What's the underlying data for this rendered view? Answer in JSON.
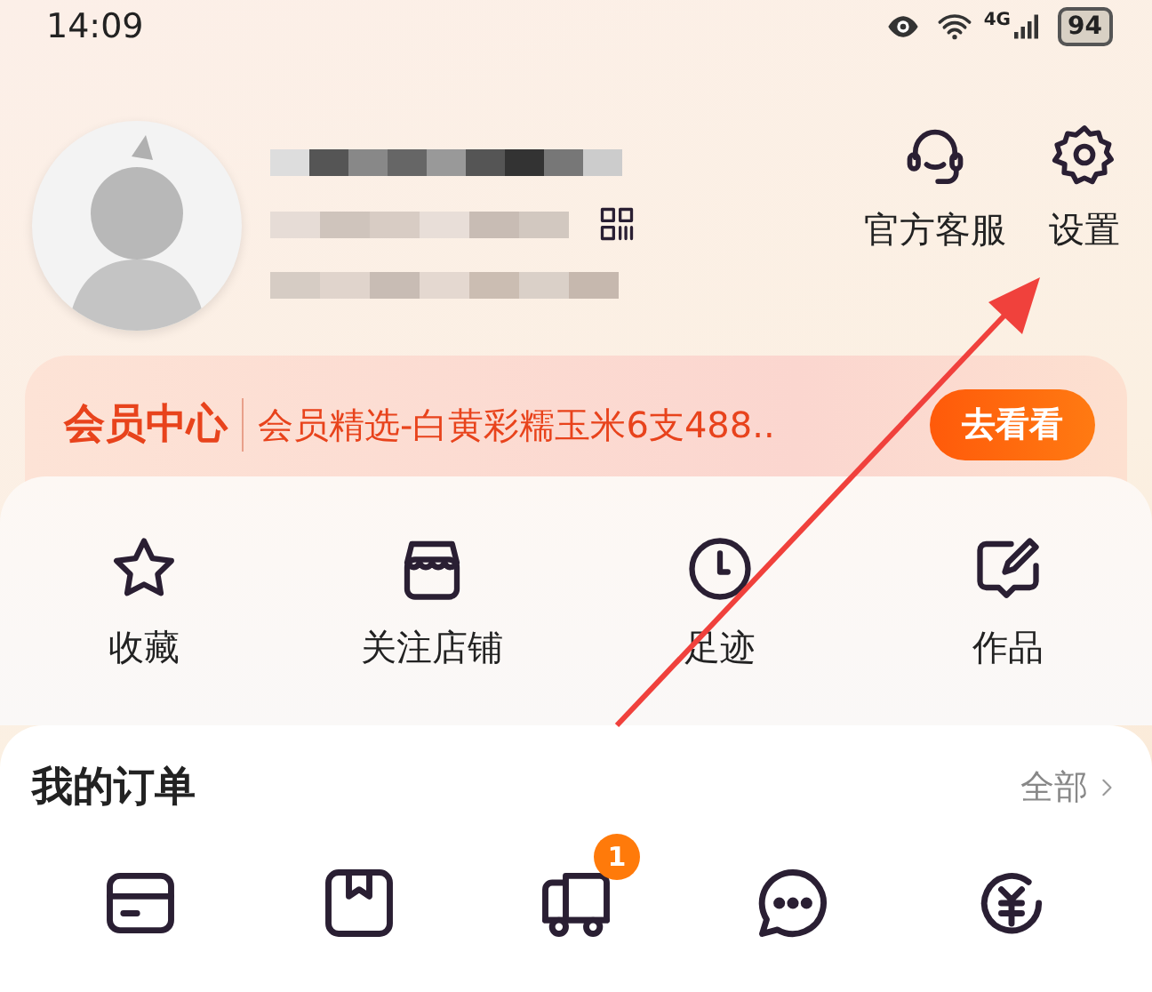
{
  "status_bar": {
    "time": "14:09",
    "network": "4G",
    "battery": "94"
  },
  "header_actions": [
    {
      "kind": "service",
      "label": "官方客服"
    },
    {
      "kind": "settings",
      "label": "设置"
    }
  ],
  "member_banner": {
    "title": "会员中心",
    "promo": "会员精选-白黄彩糯玉米6支488..",
    "button": "去看看"
  },
  "shortcuts": [
    {
      "kind": "star",
      "label": "收藏"
    },
    {
      "kind": "shop",
      "label": "关注店铺"
    },
    {
      "kind": "clock",
      "label": "足迹"
    },
    {
      "kind": "edit",
      "label": "作品"
    }
  ],
  "orders": {
    "title": "我的订单",
    "all_link": "全部",
    "items": [
      {
        "kind": "card"
      },
      {
        "kind": "box"
      },
      {
        "kind": "truck",
        "badge": "1"
      },
      {
        "kind": "chat"
      },
      {
        "kind": "refund"
      }
    ]
  }
}
